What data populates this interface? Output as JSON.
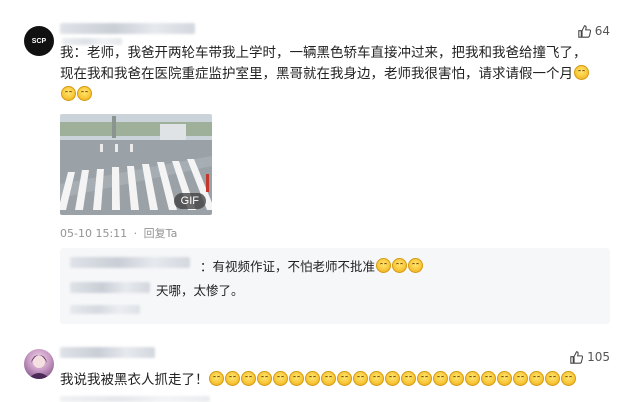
{
  "comment1": {
    "avatar_text": "SCP",
    "like_count": "64",
    "body_line1": "我：老师，我爸开两轮车带我上学时，一辆黑色轿车直接冲过来，把我和我爸给撞飞了，",
    "body_line2": "现在我和我爸在医院重症监护室里，黑哥就在我身边，老师我很害怕，请求请假一个月",
    "line1_emojis": 0,
    "line2_emojis": 1,
    "line3_emojis": 2,
    "media_badge": "GIF",
    "timestamp": "05-10 15:11",
    "separator": "·",
    "reply_action": "回复Ta"
  },
  "replies": [
    {
      "text": "：有视频作证，不怕老师不批准",
      "emojis": 3
    },
    {
      "text": "天哪，太惨了。",
      "emojis": 0
    }
  ],
  "comment2": {
    "like_count": "105",
    "body": "我说我被黑衣人抓走了！",
    "emojis": 23
  },
  "icons": {
    "like": "thumbs-up-icon",
    "emoji": "grinning-face-emoji"
  }
}
